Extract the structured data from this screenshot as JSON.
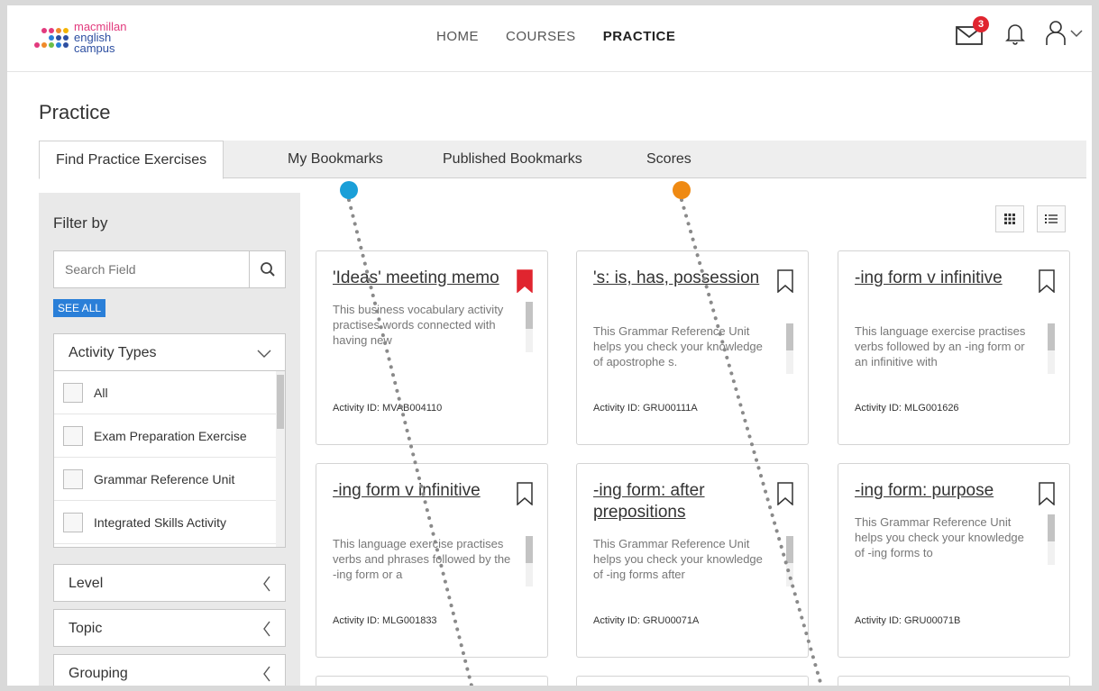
{
  "header": {
    "logo": {
      "line1": "macmillan",
      "line2": "english",
      "line3": "campus"
    },
    "nav": [
      {
        "label": "HOME",
        "active": false
      },
      {
        "label": "COURSES",
        "active": false
      },
      {
        "label": "PRACTICE",
        "active": true
      }
    ],
    "mail_count": "3",
    "icons": [
      "mail-icon",
      "bell-icon",
      "user-icon",
      "chevron-down-icon"
    ]
  },
  "page": {
    "title": "Practice"
  },
  "tabs": [
    {
      "label": "Find Practice Exercises",
      "active": true
    },
    {
      "label": "My Bookmarks",
      "active": false
    },
    {
      "label": "Published Bookmarks",
      "active": false
    },
    {
      "label": "Scores",
      "active": false
    }
  ],
  "filter": {
    "title": "Filter by",
    "search_placeholder": "Search Field",
    "see_all": "SEE ALL",
    "activity_types": {
      "label": "Activity Types",
      "options": [
        "All",
        "Exam Preparation Exercise",
        "Grammar Reference Unit",
        "Integrated Skills Activity"
      ]
    },
    "level": "Level",
    "topic": "Topic",
    "grouping": "Grouping"
  },
  "cards": [
    {
      "title": "'Ideas' meeting memo",
      "bookmarked": true,
      "desc": "This business vocabulary activity practises words connected with having new",
      "aid": "Activity ID: MVAB004110"
    },
    {
      "title": "'s: is, has, possession",
      "bookmarked": false,
      "desc": "This Grammar Reference Unit helps you check your knowledge of apostrophe s.",
      "aid": "Activity ID: GRU00111A"
    },
    {
      "title": "-ing form v infinitive",
      "bookmarked": false,
      "desc": "This language exercise practises verbs followed by an -ing form or an infinitive with",
      "aid": "Activity ID: MLG001626"
    },
    {
      "title": "-ing form v infinitive",
      "bookmarked": false,
      "desc": "This language exercise practises verbs and phrases followed by the -ing form or a",
      "aid": "Activity ID: MLG001833"
    },
    {
      "title": "-ing form: after prepositions",
      "bookmarked": false,
      "desc": "This Grammar Reference Unit helps you check your knowledge of -ing forms after",
      "aid": "Activity ID: GRU00071A"
    },
    {
      "title": "-ing form: purpose",
      "bookmarked": false,
      "desc": "This Grammar Reference Unit helps you check your knowledge of -ing forms to",
      "aid": "Activity ID: GRU00071B"
    }
  ],
  "colors": {
    "accent_blue": "#2a7fd8",
    "bookmark_red": "#e0252f",
    "marker_blue": "#1a9fd8",
    "marker_orange": "#ef8a13"
  }
}
